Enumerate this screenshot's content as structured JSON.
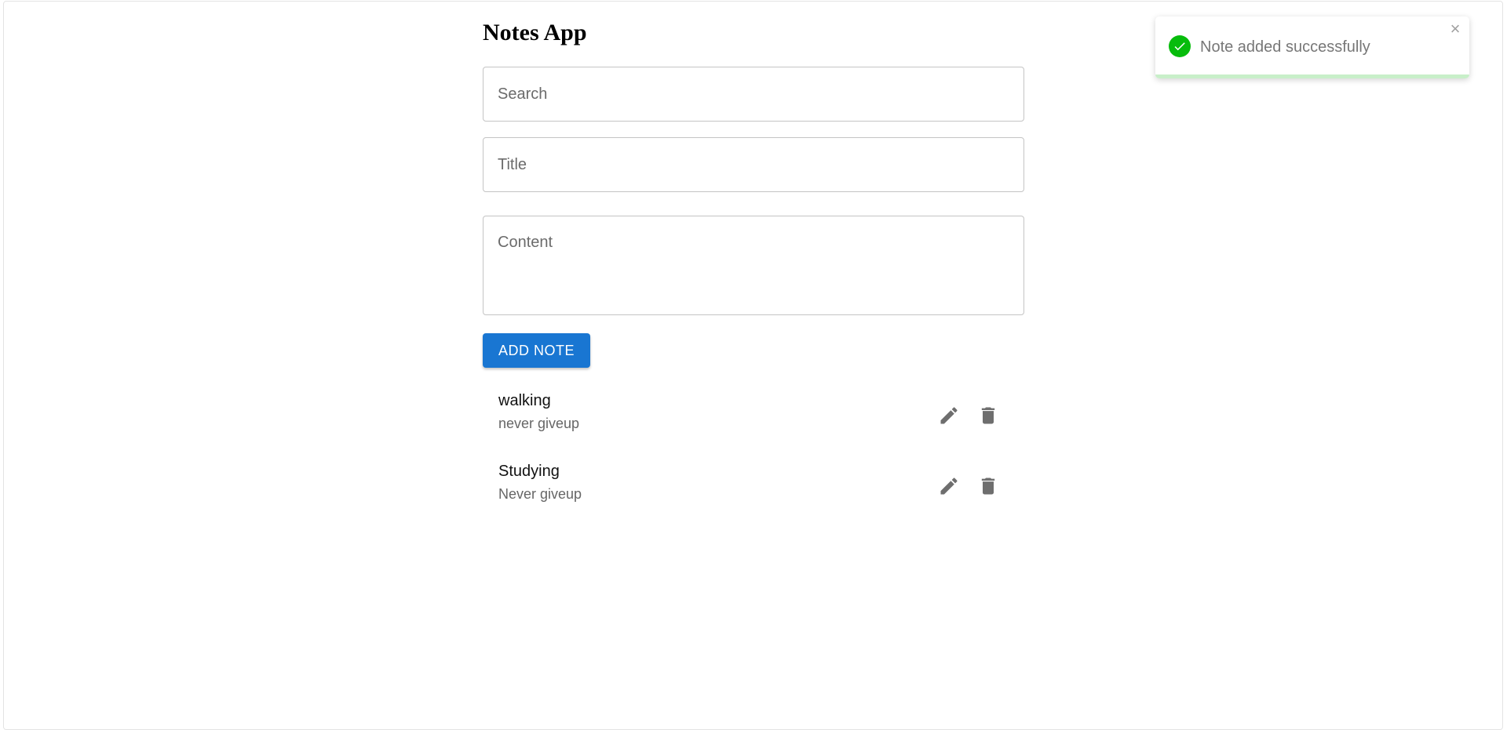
{
  "app": {
    "title": "Notes App"
  },
  "form": {
    "search_placeholder": "Search",
    "search_value": "",
    "title_placeholder": "Title",
    "title_value": "",
    "content_placeholder": "Content",
    "content_value": "",
    "add_button_label": "ADD NOTE"
  },
  "notes": [
    {
      "title": "walking",
      "content": "never giveup"
    },
    {
      "title": "Studying",
      "content": "Never giveup"
    }
  ],
  "note_actions": {
    "edit_icon": "pencil-icon",
    "delete_icon": "trash-icon"
  },
  "toast": {
    "message": "Note added successfully",
    "status": "success",
    "icon": "check-circle-icon",
    "close_symbol": "×",
    "progress": 1.0
  },
  "colors": {
    "primary": "#1976d2",
    "success": "#07bc0c",
    "icon_gray": "#6e6e6e",
    "toast_progress": "#c8efc9"
  }
}
